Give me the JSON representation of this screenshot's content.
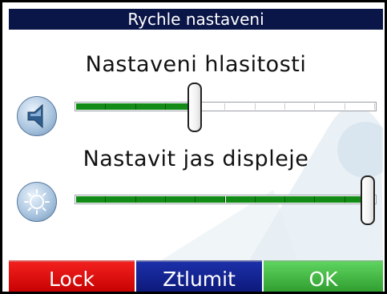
{
  "title": "Rychle nastaveni",
  "volume": {
    "label": "Nastaveni hlasitosti",
    "icon": "speaker-icon",
    "level": 0.4,
    "segments": 10,
    "filled_segments": 4
  },
  "brightness": {
    "label": "Nastavit jas displeje",
    "icon": "sun-icon",
    "level": 1.0,
    "segments": 10,
    "filled_segments": 10
  },
  "buttons": {
    "lock": "Lock",
    "mute": "Ztlumit",
    "ok": "OK"
  },
  "colors": {
    "titlebar": "#0b1648",
    "slider_fill": "#128c17",
    "lock": "#e00f0f",
    "mute": "#1a2a9a",
    "ok": "#3cb73c"
  }
}
